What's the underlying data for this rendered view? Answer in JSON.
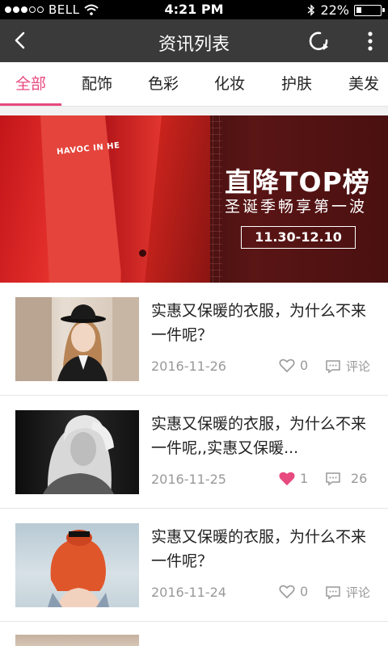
{
  "status_bar": {
    "carrier": "BELL",
    "time": "4:21 PM",
    "battery_percent": "22%",
    "battery_level": 0.22,
    "signal_dots_filled": 3,
    "signal_dots_total": 5
  },
  "nav": {
    "title": "资讯列表",
    "back_icon": "chevron-left-icon",
    "refresh_icon": "refresh-icon",
    "more_icon": "more-vertical-icon"
  },
  "tabs": [
    {
      "label": "全部",
      "active": true
    },
    {
      "label": "配饰",
      "active": false
    },
    {
      "label": "色彩",
      "active": false
    },
    {
      "label": "化妆",
      "active": false
    },
    {
      "label": "护肤",
      "active": false
    },
    {
      "label": "美发",
      "active": false
    }
  ],
  "banner": {
    "headline": "直降TOP榜",
    "subline": "圣诞季畅享第一波",
    "date_range": "11.30-12.10",
    "shirt_text": "HAVOC IN HE"
  },
  "articles": [
    {
      "title": "实惠又保暖的衣服，为什么不来一件呢？",
      "date": "2016-11-26",
      "likes": "0",
      "liked": false,
      "comments": "评论"
    },
    {
      "title": "实惠又保暖的衣服，为什么不来一件呢,,实惠又保暖...",
      "date": "2016-11-25",
      "likes": "1",
      "liked": true,
      "comments": "26"
    },
    {
      "title": "实惠又保暖的衣服，为什么不来一件呢？",
      "date": "2016-11-24",
      "likes": "0",
      "liked": false,
      "comments": "评论"
    }
  ],
  "colors": {
    "accent": "#e84a7f",
    "nav_bg": "#3a3a3a",
    "muted_text": "#999999"
  }
}
